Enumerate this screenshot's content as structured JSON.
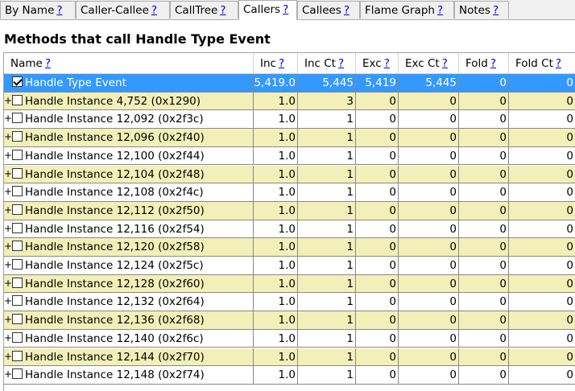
{
  "tabs": [
    {
      "label": "By Name",
      "help": "?"
    },
    {
      "label": "Caller-Callee",
      "help": "?"
    },
    {
      "label": "CallTree",
      "help": "?"
    },
    {
      "label": "Callers",
      "help": "?"
    },
    {
      "label": "Callees",
      "help": "?"
    },
    {
      "label": "Flame Graph",
      "help": "?"
    },
    {
      "label": "Notes",
      "help": "?"
    }
  ],
  "active_tab": "Callers",
  "page_title": "Methods that call Handle Type Event",
  "columns": [
    {
      "label": "Name",
      "help": "?"
    },
    {
      "label": "Inc",
      "help": "?"
    },
    {
      "label": "Inc Ct",
      "help": "?"
    },
    {
      "label": "Exc",
      "help": "?"
    },
    {
      "label": "Exc Ct",
      "help": "?"
    },
    {
      "label": "Fold",
      "help": "?"
    },
    {
      "label": "Fold Ct",
      "help": "?"
    }
  ],
  "rows": [
    {
      "name": "Handle Type Event",
      "inc": "5,419.0",
      "inc_ct": "5,445",
      "exc": "5,419",
      "exc_ct": "5,445",
      "fold": "0",
      "fold_ct": "0",
      "expander": "",
      "checked": true
    },
    {
      "name": "Handle Instance 4,752 (0x1290)",
      "inc": "1.0",
      "inc_ct": "3",
      "exc": "0",
      "exc_ct": "0",
      "fold": "0",
      "fold_ct": "0",
      "expander": "+",
      "checked": false
    },
    {
      "name": "Handle Instance 12,092 (0x2f3c)",
      "inc": "1.0",
      "inc_ct": "1",
      "exc": "0",
      "exc_ct": "0",
      "fold": "0",
      "fold_ct": "0",
      "expander": "+",
      "checked": false
    },
    {
      "name": "Handle Instance 12,096 (0x2f40)",
      "inc": "1.0",
      "inc_ct": "1",
      "exc": "0",
      "exc_ct": "0",
      "fold": "0",
      "fold_ct": "0",
      "expander": "+",
      "checked": false
    },
    {
      "name": "Handle Instance 12,100 (0x2f44)",
      "inc": "1.0",
      "inc_ct": "1",
      "exc": "0",
      "exc_ct": "0",
      "fold": "0",
      "fold_ct": "0",
      "expander": "+",
      "checked": false
    },
    {
      "name": "Handle Instance 12,104 (0x2f48)",
      "inc": "1.0",
      "inc_ct": "1",
      "exc": "0",
      "exc_ct": "0",
      "fold": "0",
      "fold_ct": "0",
      "expander": "+",
      "checked": false
    },
    {
      "name": "Handle Instance 12,108 (0x2f4c)",
      "inc": "1.0",
      "inc_ct": "1",
      "exc": "0",
      "exc_ct": "0",
      "fold": "0",
      "fold_ct": "0",
      "expander": "+",
      "checked": false
    },
    {
      "name": "Handle Instance 12,112 (0x2f50)",
      "inc": "1.0",
      "inc_ct": "1",
      "exc": "0",
      "exc_ct": "0",
      "fold": "0",
      "fold_ct": "0",
      "expander": "+",
      "checked": false
    },
    {
      "name": "Handle Instance 12,116 (0x2f54)",
      "inc": "1.0",
      "inc_ct": "1",
      "exc": "0",
      "exc_ct": "0",
      "fold": "0",
      "fold_ct": "0",
      "expander": "+",
      "checked": false
    },
    {
      "name": "Handle Instance 12,120 (0x2f58)",
      "inc": "1.0",
      "inc_ct": "1",
      "exc": "0",
      "exc_ct": "0",
      "fold": "0",
      "fold_ct": "0",
      "expander": "+",
      "checked": false
    },
    {
      "name": "Handle Instance 12,124 (0x2f5c)",
      "inc": "1.0",
      "inc_ct": "1",
      "exc": "0",
      "exc_ct": "0",
      "fold": "0",
      "fold_ct": "0",
      "expander": "+",
      "checked": false
    },
    {
      "name": "Handle Instance 12,128 (0x2f60)",
      "inc": "1.0",
      "inc_ct": "1",
      "exc": "0",
      "exc_ct": "0",
      "fold": "0",
      "fold_ct": "0",
      "expander": "+",
      "checked": false
    },
    {
      "name": "Handle Instance 12,132 (0x2f64)",
      "inc": "1.0",
      "inc_ct": "1",
      "exc": "0",
      "exc_ct": "0",
      "fold": "0",
      "fold_ct": "0",
      "expander": "+",
      "checked": false
    },
    {
      "name": "Handle Instance 12,136 (0x2f68)",
      "inc": "1.0",
      "inc_ct": "1",
      "exc": "0",
      "exc_ct": "0",
      "fold": "0",
      "fold_ct": "0",
      "expander": "+",
      "checked": false
    },
    {
      "name": "Handle Instance 12,140 (0x2f6c)",
      "inc": "1.0",
      "inc_ct": "1",
      "exc": "0",
      "exc_ct": "0",
      "fold": "0",
      "fold_ct": "0",
      "expander": "+",
      "checked": false
    },
    {
      "name": "Handle Instance 12,144 (0x2f70)",
      "inc": "1.0",
      "inc_ct": "1",
      "exc": "0",
      "exc_ct": "0",
      "fold": "0",
      "fold_ct": "0",
      "expander": "+",
      "checked": false
    },
    {
      "name": "Handle Instance 12,148 (0x2f74)",
      "inc": "1.0",
      "inc_ct": "1",
      "exc": "0",
      "exc_ct": "0",
      "fold": "0",
      "fold_ct": "0",
      "expander": "+",
      "checked": false
    }
  ],
  "colors": {
    "selection": "#3399ff",
    "alt_row": "#f2f0b8",
    "link": "#0000ee"
  }
}
